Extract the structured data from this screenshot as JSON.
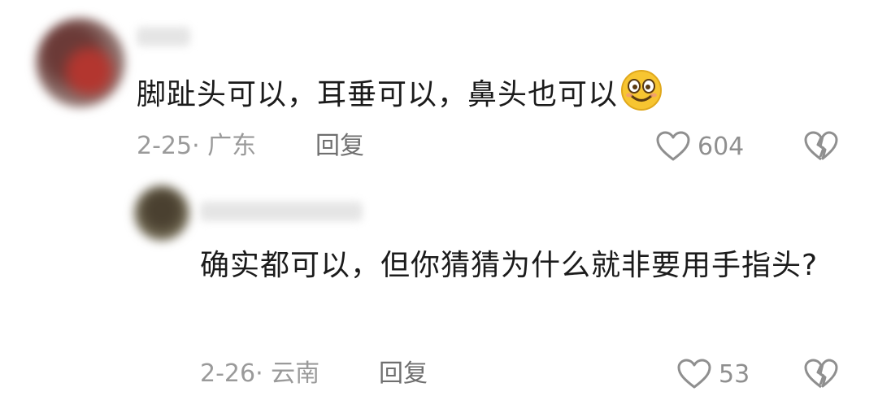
{
  "comments": [
    {
      "text": "脚趾头可以，耳垂可以，鼻头也可以",
      "emoji": "smiling-face-icon",
      "meta": "2-25· 广东",
      "reply_label": "回复",
      "likes": "604"
    },
    {
      "text": "确实都可以，但你猜猜为什么就非要用手指头?",
      "meta": "2-26· 云南",
      "reply_label": "回复",
      "likes": "53"
    }
  ],
  "icons": {
    "like": "heart-outline-icon",
    "dislike": "broken-heart-icon"
  },
  "colors": {
    "text": "#1b1b1b",
    "meta": "#9a9a9a",
    "icon": "#8f8f8f"
  }
}
